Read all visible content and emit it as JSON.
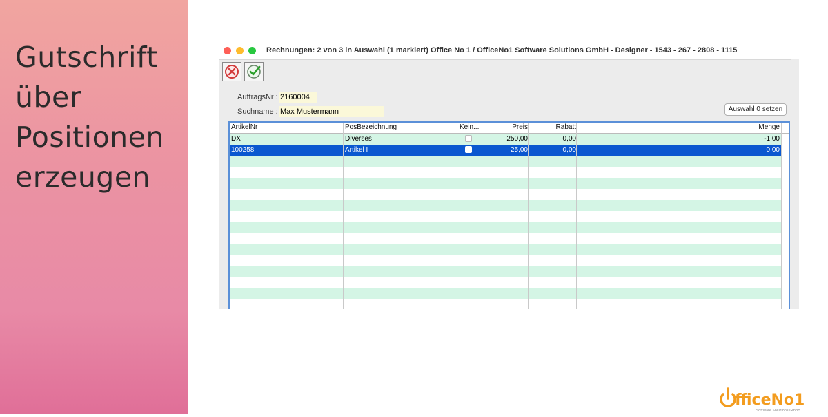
{
  "slide": {
    "title_lines": [
      "Gutschrift",
      "über",
      "Positionen",
      "erzeugen"
    ]
  },
  "window": {
    "title": "Rechnungen: 2 von 3 in Auswahl  (1 markiert) Office No 1 /  OfficeNo1 Software Solutions GmbH - Designer - 1543 - 267 - 2808 - 1115",
    "cancel_icon": "cancel-icon",
    "ok_icon": "checkmark-icon"
  },
  "form": {
    "auftragsnr_label": "AuftragsNr :",
    "auftragsnr_value": "2160004",
    "suchname_label": "Suchname :",
    "suchname_value": "Max Mustermann",
    "reset_button": "Auswahl 0 setzen"
  },
  "table": {
    "columns": [
      "ArtikelNr",
      "PosBezeichnung",
      "Kein...",
      "Preis",
      "Rabatt",
      "Menge"
    ],
    "rows": [
      {
        "artikelnr": "DX",
        "bezeichnung": "Diverses",
        "kein": false,
        "preis": "250,00",
        "rabatt": "0,00",
        "menge": "-1,00",
        "selected": false
      },
      {
        "artikelnr": "100258",
        "bezeichnung": "Artikel I",
        "kein": false,
        "preis": "25,00",
        "rabatt": "0,00",
        "menge": "0,00",
        "selected": true
      }
    ],
    "colors": {
      "stripe": "#d4f5e5",
      "selected": "#0a58d0",
      "white": "#ffffff"
    }
  },
  "logo": {
    "text": "OfficeNo1",
    "subtitle": "Software Solutions GmbH",
    "color": "#f39c1e"
  }
}
